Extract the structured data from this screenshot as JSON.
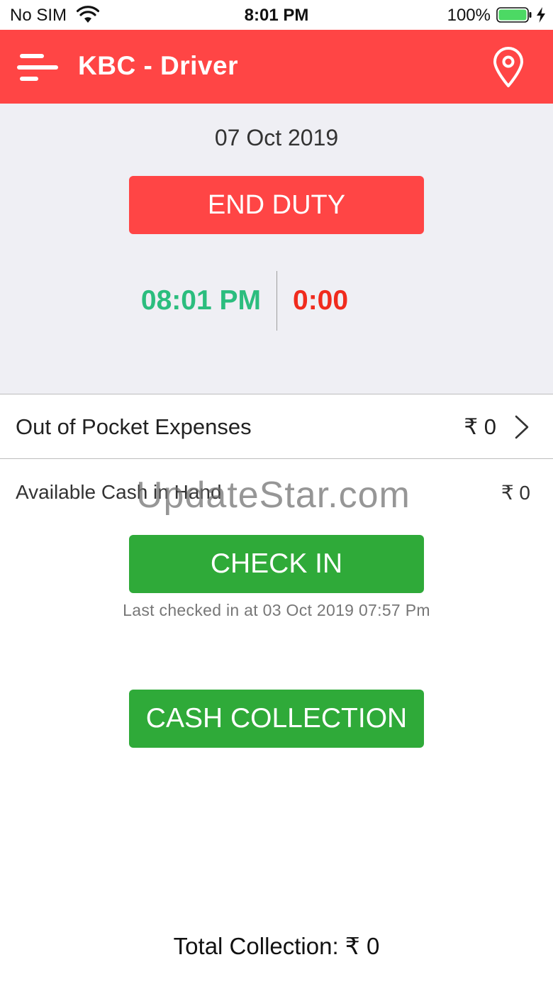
{
  "status_bar": {
    "carrier": "No SIM",
    "time": "8:01 PM",
    "battery_percent": "100%",
    "battery_color": "#4cd964"
  },
  "header": {
    "title": "KBC - Driver",
    "background": "#ff4545",
    "menu_icon": "hamburger-menu-icon",
    "location_icon": "map-pin-icon"
  },
  "duty": {
    "date": "07 Oct 2019",
    "end_duty_label": "END DUTY",
    "start_time": "08:01 PM",
    "elapsed": "0:00",
    "start_time_color": "#2bbd7e",
    "elapsed_color": "#f02b1d"
  },
  "expenses": {
    "label": "Out of Pocket Expenses",
    "value": "₹ 0",
    "chevron_icon": "chevron-right-icon"
  },
  "cash": {
    "label": "Available Cash in Hand",
    "value": "₹ 0"
  },
  "watermark": "UpdateStar.com",
  "check_in": {
    "label": "CHECK IN",
    "last_checked": "Last checked in at 03 Oct 2019 07:57 Pm"
  },
  "cash_collection": {
    "label": "CASH COLLECTION",
    "button_color": "#2faa39"
  },
  "total": {
    "label": "Total Collection: ₹ 0"
  }
}
